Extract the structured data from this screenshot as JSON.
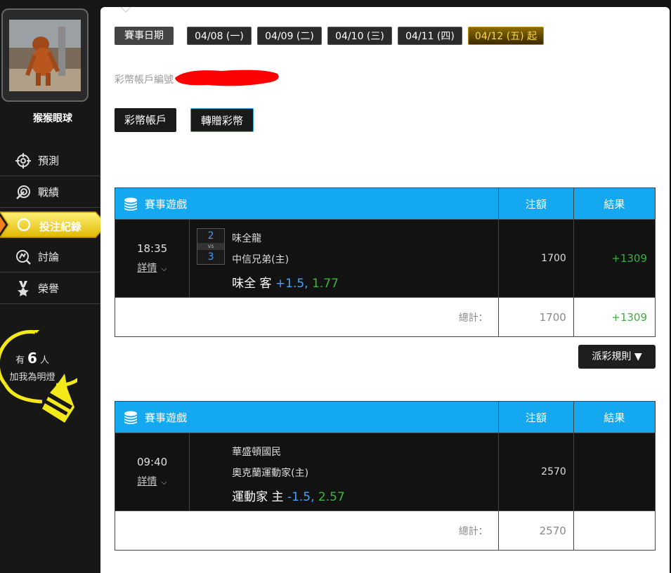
{
  "sidebar": {
    "username": "猴猴眼球",
    "nav": [
      {
        "label": "預測",
        "icon": "crosshair-icon"
      },
      {
        "label": "戰績",
        "icon": "target-icon"
      },
      {
        "label": "投注紀錄",
        "icon": "history-icon"
      },
      {
        "label": "討論",
        "icon": "discussion-icon"
      },
      {
        "label": "榮譽",
        "icon": "medal-icon"
      }
    ],
    "bulb": {
      "prefix": "有",
      "count": "6",
      "suffix": "人",
      "line2": "加我為明燈"
    }
  },
  "dates": {
    "label": "賽事日期",
    "items": [
      "04/08 (一)",
      "04/09 (二)",
      "04/10 (三)",
      "04/11 (四)",
      "04/12 (五) 起"
    ],
    "active_index": 4
  },
  "account": {
    "number_label": "彩幣帳戶編號",
    "btn_account": "彩幣帳戶",
    "btn_transfer": "轉贈彩幣"
  },
  "table_headers": {
    "game": "賽事遊戲",
    "bet": "注額",
    "result": "結果"
  },
  "games": [
    {
      "time": "18:35",
      "detail": "詳情",
      "score_home": "2",
      "score_vs": "vs",
      "score_away": "3",
      "team1": "味全龍",
      "team2": "中信兄弟(主)",
      "pick_team": "味全 客",
      "pick_spread": "+1.5,",
      "pick_odds": "1.77",
      "bet": "1700",
      "result": "+1309",
      "total_label": "總計：",
      "total_bet": "1700",
      "total_result": "+1309"
    },
    {
      "time": "09:40",
      "detail": "詳情",
      "team1": "華盛頓國民",
      "team2": "奧克蘭運動家(主)",
      "pick_team": "運動家 主",
      "pick_spread": "-1.5,",
      "pick_odds": "2.57",
      "bet": "2570",
      "result": "",
      "total_label": "總計：",
      "total_bet": "2570",
      "total_result": ""
    }
  ],
  "rules_button": "派彩規則 ▼",
  "colors": {
    "accent_blue": "#14a8f0",
    "win_green": "#3ab03a",
    "active_yellow": "#f0d020"
  }
}
